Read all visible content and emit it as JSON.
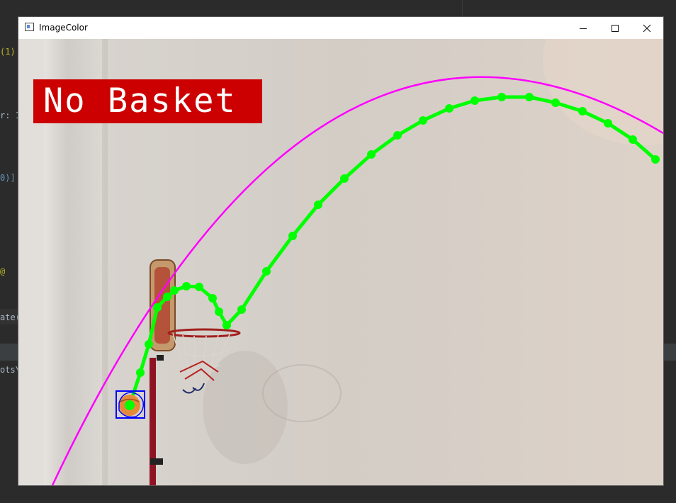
{
  "window": {
    "title": "ImageColor",
    "controls": {
      "minimize": "minimize",
      "maximize": "maximize",
      "close": "close"
    }
  },
  "overlay": {
    "result_label": "No Basket",
    "result_bg_color": "#cc0000",
    "result_text_color": "#ffffff"
  },
  "tracking": {
    "trajectory_color": "#00ff00",
    "prediction_color": "#ff00ff",
    "box_color": "#0000ff"
  },
  "ide_background": {
    "fragments": [
      "(1)",
      "r: 1",
      "0)]",
      "@",
      "ate(",
      "ots\\"
    ]
  }
}
